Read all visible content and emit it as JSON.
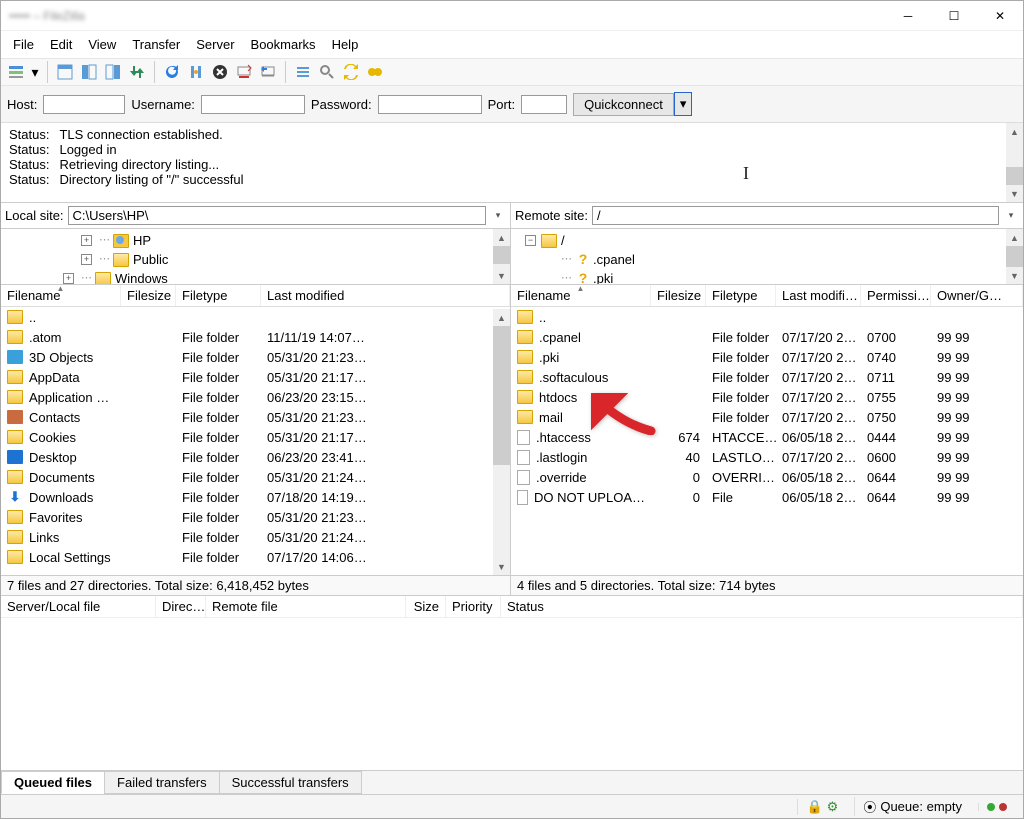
{
  "window": {
    "title": "••••• – FileZilla"
  },
  "menu": [
    "File",
    "Edit",
    "View",
    "Transfer",
    "Server",
    "Bookmarks",
    "Help"
  ],
  "connect": {
    "host_label": "Host:",
    "user_label": "Username:",
    "pass_label": "Password:",
    "port_label": "Port:",
    "quickconnect": "Quickconnect"
  },
  "status_lines": [
    [
      "Status:",
      "TLS connection established."
    ],
    [
      "Status:",
      "Logged in"
    ],
    [
      "Status:",
      "Retrieving directory listing..."
    ],
    [
      "Status:",
      "Directory listing of \"/\" successful"
    ]
  ],
  "local": {
    "label": "Local site:",
    "path": "C:\\Users\\HP\\",
    "tree": [
      {
        "indent": 3,
        "expander": "+",
        "icon": "user",
        "label": "HP"
      },
      {
        "indent": 3,
        "expander": "+",
        "icon": "folder",
        "label": "Public"
      },
      {
        "indent": 2,
        "expander": "+",
        "icon": "folder",
        "label": "Windows"
      }
    ],
    "columns": [
      "Filename",
      "Filesize",
      "Filetype",
      "Last modified"
    ],
    "rows": [
      {
        "icon": "folder",
        "name": "..",
        "size": "",
        "type": "",
        "mod": ""
      },
      {
        "icon": "folder",
        "name": ".atom",
        "size": "",
        "type": "File folder",
        "mod": "11/11/19 14:07…"
      },
      {
        "icon": "3d",
        "name": "3D Objects",
        "size": "",
        "type": "File folder",
        "mod": "05/31/20 21:23…"
      },
      {
        "icon": "folder",
        "name": "AppData",
        "size": "",
        "type": "File folder",
        "mod": "05/31/20 21:17…"
      },
      {
        "icon": "folder",
        "name": "Application …",
        "size": "",
        "type": "File folder",
        "mod": "06/23/20 23:15…"
      },
      {
        "icon": "contacts",
        "name": "Contacts",
        "size": "",
        "type": "File folder",
        "mod": "05/31/20 21:23…"
      },
      {
        "icon": "folder",
        "name": "Cookies",
        "size": "",
        "type": "File folder",
        "mod": "05/31/20 21:17…"
      },
      {
        "icon": "desktop",
        "name": "Desktop",
        "size": "",
        "type": "File folder",
        "mod": "06/23/20 23:41…"
      },
      {
        "icon": "folder",
        "name": "Documents",
        "size": "",
        "type": "File folder",
        "mod": "05/31/20 21:24…"
      },
      {
        "icon": "download",
        "name": "Downloads",
        "size": "",
        "type": "File folder",
        "mod": "07/18/20 14:19…"
      },
      {
        "icon": "folder",
        "name": "Favorites",
        "size": "",
        "type": "File folder",
        "mod": "05/31/20 21:23…"
      },
      {
        "icon": "folder",
        "name": "Links",
        "size": "",
        "type": "File folder",
        "mod": "05/31/20 21:24…"
      },
      {
        "icon": "folder",
        "name": "Local Settings",
        "size": "",
        "type": "File folder",
        "mod": "07/17/20 14:06…"
      }
    ],
    "summary": "7 files and 27 directories. Total size: 6,418,452 bytes"
  },
  "remote": {
    "label": "Remote site:",
    "path": "/",
    "tree": [
      {
        "indent": 0,
        "expander": "-",
        "icon": "folder",
        "label": "/"
      },
      {
        "indent": 1,
        "expander": "",
        "icon": "q",
        "label": ".cpanel"
      },
      {
        "indent": 1,
        "expander": "",
        "icon": "q",
        "label": ".pki"
      }
    ],
    "columns": [
      "Filename",
      "Filesize",
      "Filetype",
      "Last modifi…",
      "Permissi…",
      "Owner/G…"
    ],
    "rows": [
      {
        "icon": "folder",
        "name": "..",
        "size": "",
        "type": "",
        "mod": "",
        "perm": "",
        "own": ""
      },
      {
        "icon": "folder",
        "name": ".cpanel",
        "size": "",
        "type": "File folder",
        "mod": "07/17/20 2…",
        "perm": "0700",
        "own": "99 99"
      },
      {
        "icon": "folder",
        "name": ".pki",
        "size": "",
        "type": "File folder",
        "mod": "07/17/20 2…",
        "perm": "0740",
        "own": "99 99"
      },
      {
        "icon": "folder",
        "name": ".softaculous",
        "size": "",
        "type": "File folder",
        "mod": "07/17/20 2…",
        "perm": "0711",
        "own": "99 99"
      },
      {
        "icon": "folder",
        "name": "htdocs",
        "size": "",
        "type": "File folder",
        "mod": "07/17/20 2…",
        "perm": "0755",
        "own": "99 99"
      },
      {
        "icon": "folder",
        "name": "mail",
        "size": "",
        "type": "File folder",
        "mod": "07/17/20 2…",
        "perm": "0750",
        "own": "99 99"
      },
      {
        "icon": "file",
        "name": ".htaccess",
        "size": "674",
        "type": "HTACCE…",
        "mod": "06/05/18 2…",
        "perm": "0444",
        "own": "99 99"
      },
      {
        "icon": "file",
        "name": ".lastlogin",
        "size": "40",
        "type": "LASTLO…",
        "mod": "07/17/20 2…",
        "perm": "0600",
        "own": "99 99"
      },
      {
        "icon": "file",
        "name": ".override",
        "size": "0",
        "type": "OVERRI…",
        "mod": "06/05/18 2…",
        "perm": "0644",
        "own": "99 99"
      },
      {
        "icon": "file",
        "name": "DO NOT UPLOA…",
        "size": "0",
        "type": "File",
        "mod": "06/05/18 2…",
        "perm": "0644",
        "own": "99 99"
      }
    ],
    "summary": "4 files and 5 directories. Total size: 714 bytes"
  },
  "queue": {
    "columns": [
      "Server/Local file",
      "Direc…",
      "Remote file",
      "Size",
      "Priority",
      "Status"
    ]
  },
  "tabs": [
    "Queued files",
    "Failed transfers",
    "Successful transfers"
  ],
  "statusbar": {
    "queue": "Queue: empty"
  }
}
